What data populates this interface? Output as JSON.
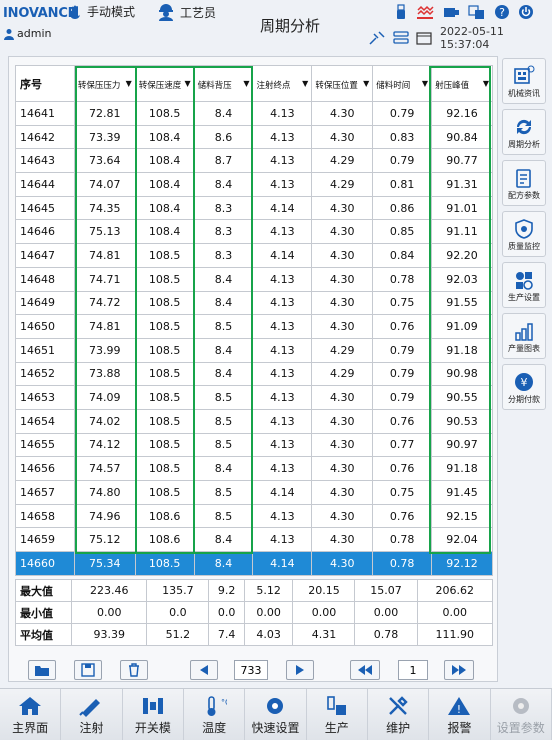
{
  "header": {
    "logo": "INOVANCE",
    "mode": "手动模式",
    "role": "工艺员",
    "user": "admin",
    "title": "周期分析",
    "datetime": "2022-05-11 15:37:04"
  },
  "table": {
    "columns": [
      "序号",
      "转保压压力",
      "转保压速度",
      "储料背压",
      "注射终点",
      "转保压位置",
      "储料时间",
      "射压峰值"
    ],
    "rows": [
      [
        "14641",
        "72.81",
        "108.5",
        "8.4",
        "4.13",
        "4.30",
        "0.79",
        "92.16"
      ],
      [
        "14642",
        "73.39",
        "108.4",
        "8.6",
        "4.13",
        "4.30",
        "0.83",
        "90.84"
      ],
      [
        "14643",
        "73.64",
        "108.4",
        "8.7",
        "4.13",
        "4.29",
        "0.79",
        "90.77"
      ],
      [
        "14644",
        "74.07",
        "108.4",
        "8.4",
        "4.13",
        "4.29",
        "0.81",
        "91.31"
      ],
      [
        "14645",
        "74.35",
        "108.4",
        "8.3",
        "4.14",
        "4.30",
        "0.86",
        "91.01"
      ],
      [
        "14646",
        "75.13",
        "108.4",
        "8.3",
        "4.13",
        "4.30",
        "0.85",
        "91.11"
      ],
      [
        "14647",
        "74.81",
        "108.5",
        "8.3",
        "4.14",
        "4.30",
        "0.84",
        "92.20"
      ],
      [
        "14648",
        "74.71",
        "108.5",
        "8.4",
        "4.13",
        "4.30",
        "0.78",
        "92.03"
      ],
      [
        "14649",
        "74.72",
        "108.5",
        "8.4",
        "4.13",
        "4.30",
        "0.75",
        "91.55"
      ],
      [
        "14650",
        "74.81",
        "108.5",
        "8.5",
        "4.13",
        "4.30",
        "0.76",
        "91.09"
      ],
      [
        "14651",
        "73.99",
        "108.5",
        "8.4",
        "4.13",
        "4.29",
        "0.79",
        "91.18"
      ],
      [
        "14652",
        "73.88",
        "108.5",
        "8.4",
        "4.13",
        "4.29",
        "0.79",
        "90.98"
      ],
      [
        "14653",
        "74.09",
        "108.5",
        "8.5",
        "4.13",
        "4.30",
        "0.79",
        "90.55"
      ],
      [
        "14654",
        "74.02",
        "108.5",
        "8.5",
        "4.13",
        "4.30",
        "0.76",
        "90.53"
      ],
      [
        "14655",
        "74.12",
        "108.5",
        "8.5",
        "4.13",
        "4.30",
        "0.77",
        "90.97"
      ],
      [
        "14656",
        "74.57",
        "108.5",
        "8.4",
        "4.13",
        "4.30",
        "0.76",
        "91.18"
      ],
      [
        "14657",
        "74.80",
        "108.5",
        "8.5",
        "4.14",
        "4.30",
        "0.75",
        "91.45"
      ],
      [
        "14658",
        "74.96",
        "108.6",
        "8.5",
        "4.13",
        "4.30",
        "0.76",
        "92.15"
      ],
      [
        "14659",
        "75.12",
        "108.6",
        "8.4",
        "4.13",
        "4.30",
        "0.78",
        "92.04"
      ],
      [
        "14660",
        "75.34",
        "108.5",
        "8.4",
        "4.14",
        "4.30",
        "0.78",
        "92.12"
      ]
    ],
    "selected_index": 19
  },
  "stats": [
    {
      "label": "最大值",
      "values": [
        "223.46",
        "135.7",
        "9.2",
        "5.12",
        "20.15",
        "15.07",
        "206.62"
      ]
    },
    {
      "label": "最小值",
      "values": [
        "0.00",
        "0.0",
        "0.0",
        "0.00",
        "0.00",
        "0.00",
        "0.00"
      ]
    },
    {
      "label": "平均值",
      "values": [
        "93.39",
        "51.2",
        "7.4",
        "4.03",
        "4.31",
        "0.78",
        "111.90"
      ]
    }
  ],
  "pager": {
    "page": "733",
    "group": "1"
  },
  "sidebar": [
    {
      "label": "机械资讯",
      "icon": "machine-info-icon"
    },
    {
      "label": "周期分析",
      "icon": "cycle-analysis-icon"
    },
    {
      "label": "配方参数",
      "icon": "recipe-icon"
    },
    {
      "label": "质量监控",
      "icon": "quality-monitor-icon"
    },
    {
      "label": "生产设置",
      "icon": "production-settings-icon"
    },
    {
      "label": "产量图表",
      "icon": "output-chart-icon"
    },
    {
      "label": "分期付款",
      "icon": "installment-icon"
    }
  ],
  "footer": [
    {
      "label": "主界面",
      "icon": "home-icon"
    },
    {
      "label": "注射",
      "icon": "injection-icon"
    },
    {
      "label": "开关模",
      "icon": "mold-icon"
    },
    {
      "label": "温度",
      "icon": "temperature-icon"
    },
    {
      "label": "快速设置",
      "icon": "quick-settings-icon"
    },
    {
      "label": "生产",
      "icon": "production-icon"
    },
    {
      "label": "维护",
      "icon": "maintenance-icon"
    },
    {
      "label": "报警",
      "icon": "alarm-icon"
    },
    {
      "label": "设置参数",
      "icon": "settings-icon"
    }
  ],
  "colors": {
    "accent": "#1f8ad6",
    "highlight": "#17a34a",
    "brand": "#1a5fb4"
  }
}
